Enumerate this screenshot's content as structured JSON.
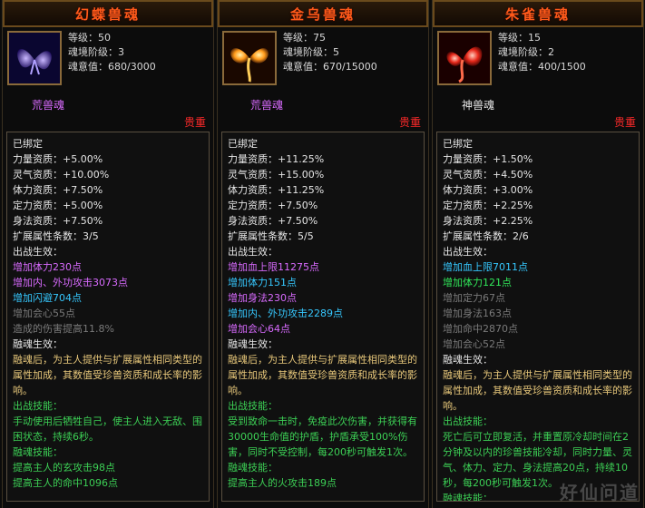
{
  "panels": [
    {
      "title": "幻蝶兽魂",
      "level": "等级：50",
      "realm": "魂境阶级：3",
      "soul": "魂意值：680/3000",
      "type": "荒兽魂",
      "type_color": "#d96bff",
      "quality": "贵重",
      "icon": "butterfly-icon",
      "lines": [
        {
          "t": "已绑定",
          "c": "white"
        },
        {
          "t": "力量资质：+5.00%",
          "c": "white"
        },
        {
          "t": "灵气资质：+10.00%",
          "c": "white"
        },
        {
          "t": "体力资质：+7.50%",
          "c": "white"
        },
        {
          "t": "定力资质：+5.00%",
          "c": "white"
        },
        {
          "t": "身法资质：+7.50%",
          "c": "white"
        },
        {
          "t": "扩展属性条数：3/5",
          "c": "white"
        },
        {
          "t": "出战生效：",
          "c": "white"
        },
        {
          "t": "增加体力230点",
          "c": "purple"
        },
        {
          "t": "增加内、外功攻击3073点",
          "c": "purple"
        },
        {
          "t": "增加闪避704点",
          "c": "cyan"
        },
        {
          "t": "增加会心55点",
          "c": "gray"
        },
        {
          "t": "造成的伤害提高11.8%",
          "c": "gray"
        },
        {
          "t": "融魂生效：",
          "c": "white"
        },
        {
          "t": "融魂后，为主人提供与扩展属性相同类型的属性加成，其数值受珍兽资质和成长率的影响。",
          "c": "gold",
          "w": true
        },
        {
          "t": "出战技能：",
          "c": "lgreen"
        },
        {
          "t": "手动使用后牺牲自己，使主人进入无敌、围困状态，持续6秒。",
          "c": "lgreen",
          "w": true
        },
        {
          "t": "融魂技能：",
          "c": "lgreen"
        },
        {
          "t": "提高主人的玄攻击98点",
          "c": "lgreen"
        },
        {
          "t": "提高主人的命中1096点",
          "c": "lgreen"
        }
      ]
    },
    {
      "title": "金乌兽魂",
      "level": "等级：75",
      "realm": "魂境阶级：5",
      "soul": "魂意值：670/15000",
      "type": "荒兽魂",
      "type_color": "#d96bff",
      "quality": "贵重",
      "icon": "phoenix-icon",
      "lines": [
        {
          "t": "已绑定",
          "c": "white"
        },
        {
          "t": "力量资质：+11.25%",
          "c": "white"
        },
        {
          "t": "灵气资质：+15.00%",
          "c": "white"
        },
        {
          "t": "体力资质：+11.25%",
          "c": "white"
        },
        {
          "t": "定力资质：+7.50%",
          "c": "white"
        },
        {
          "t": "身法资质：+7.50%",
          "c": "white"
        },
        {
          "t": "扩展属性条数：5/5",
          "c": "white"
        },
        {
          "t": "出战生效：",
          "c": "white"
        },
        {
          "t": "增加血上限11275点",
          "c": "purple"
        },
        {
          "t": "增加体力151点",
          "c": "cyan"
        },
        {
          "t": "增加身法230点",
          "c": "purple"
        },
        {
          "t": "增加内、外功攻击2289点",
          "c": "cyan"
        },
        {
          "t": "增加会心64点",
          "c": "purple"
        },
        {
          "t": "融魂生效：",
          "c": "white"
        },
        {
          "t": "融魂后，为主人提供与扩展属性相同类型的属性加成，其数值受珍兽资质和成长率的影响。",
          "c": "gold",
          "w": true
        },
        {
          "t": "出战技能：",
          "c": "lgreen"
        },
        {
          "t": "受到致命一击时，免疫此次伤害，并获得有30000生命值的护盾，护盾承受100%伤害，同时不受控制，每200秒可触发1次。",
          "c": "lgreen",
          "w": true
        },
        {
          "t": "融魂技能：",
          "c": "lgreen"
        },
        {
          "t": "提高主人的火攻击189点",
          "c": "lgreen"
        }
      ]
    },
    {
      "title": "朱雀兽魂",
      "level": "等级：15",
      "realm": "魂境阶级：2",
      "soul": "魂意值：400/1500",
      "type": "神兽魂",
      "type_color": "#e6e6e6",
      "quality": "贵重",
      "icon": "vermilion-bird-icon",
      "lines": [
        {
          "t": "已绑定",
          "c": "white"
        },
        {
          "t": "力量资质：+1.50%",
          "c": "white"
        },
        {
          "t": "灵气资质：+4.50%",
          "c": "white"
        },
        {
          "t": "体力资质：+3.00%",
          "c": "white"
        },
        {
          "t": "定力资质：+2.25%",
          "c": "white"
        },
        {
          "t": "身法资质：+2.25%",
          "c": "white"
        },
        {
          "t": "扩展属性条数：2/6",
          "c": "white"
        },
        {
          "t": "出战生效：",
          "c": "white"
        },
        {
          "t": "增加血上限7011点",
          "c": "cyan"
        },
        {
          "t": "增加体力121点",
          "c": "green"
        },
        {
          "t": "增加定力67点",
          "c": "gray"
        },
        {
          "t": "增加身法163点",
          "c": "gray"
        },
        {
          "t": "增加命中2870点",
          "c": "gray"
        },
        {
          "t": "增加会心52点",
          "c": "gray"
        },
        {
          "t": "融魂生效：",
          "c": "white"
        },
        {
          "t": "融魂后，为主人提供与扩展属性相同类型的属性加成，其数值受珍兽资质和成长率的影响。",
          "c": "gold",
          "w": true
        },
        {
          "t": "出战技能：",
          "c": "lgreen"
        },
        {
          "t": "死亡后可立即复活，并重置原冷却时间在2分钟及以内的珍兽技能冷却，同时力量、灵气、体力、定力、身法提高20点，持续10秒，每200秒可触发1次。",
          "c": "lgreen",
          "w": true
        },
        {
          "t": "融魂技能：",
          "c": "lgreen"
        }
      ]
    }
  ],
  "watermark": "好仙问道"
}
